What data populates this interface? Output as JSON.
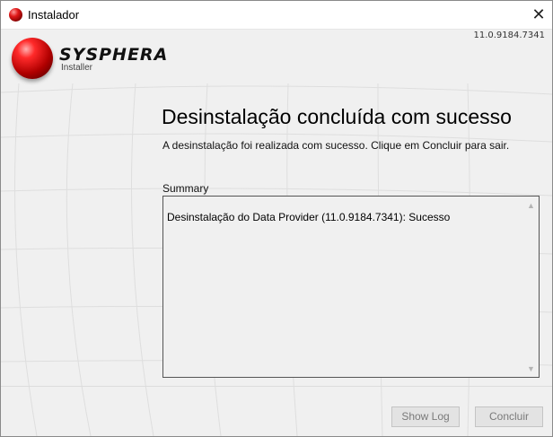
{
  "window": {
    "title": "Instalador",
    "close_glyph": "✕"
  },
  "header": {
    "version": "11.0.9184.7341",
    "brand_name": "SYSPHERA",
    "brand_sub": "Installer"
  },
  "main": {
    "heading": "Desinstalação concluída com sucesso",
    "subtitle": "A desinstalação foi realizada com sucesso. Clique em Concluir para sair.",
    "summary_label": "Summary",
    "summary_text": "Desinstalação do Data Provider (11.0.9184.7341): Sucesso"
  },
  "footer": {
    "show_log_label": "Show Log",
    "finish_label": "Concluir"
  },
  "icons": {
    "app": "sysphera-ball-icon",
    "close": "close-icon",
    "scroll_up": "chevron-up-icon",
    "scroll_down": "chevron-down-icon"
  },
  "colors": {
    "brand_red": "#d81c1c",
    "panel_bg": "#f0f0f0",
    "disabled_text": "#7a7a7a"
  }
}
